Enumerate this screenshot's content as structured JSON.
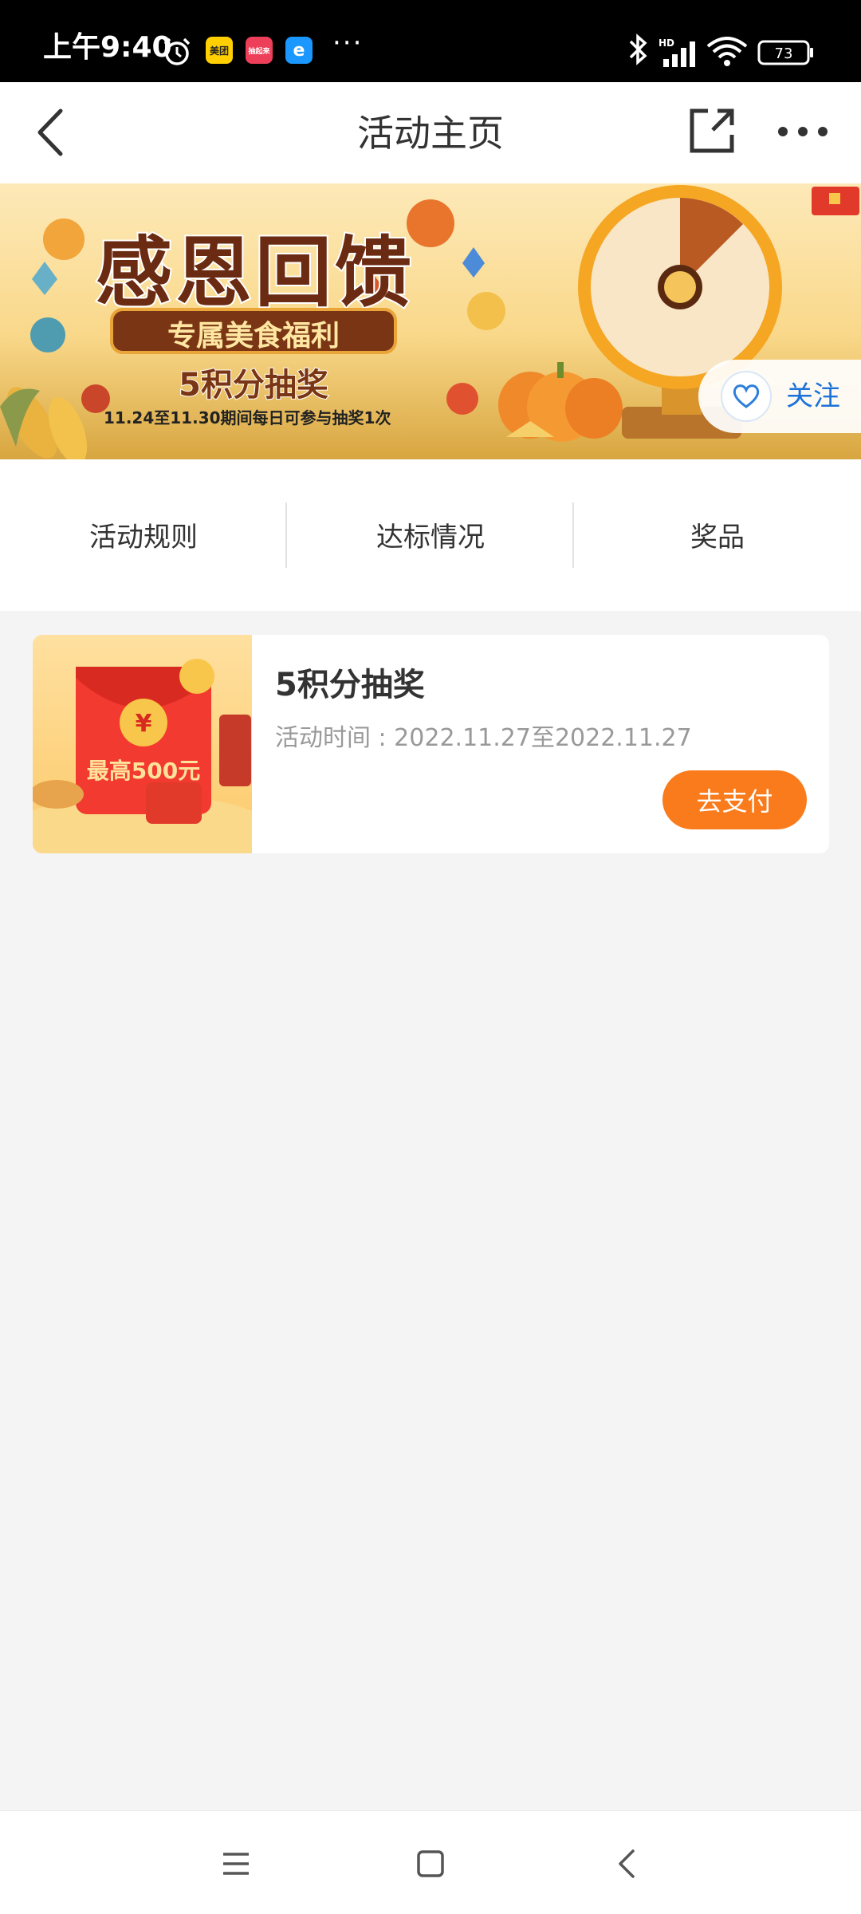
{
  "status_bar": {
    "time": "上午9:40",
    "apps": [
      {
        "name": "meituan-app-icon",
        "label": "美团",
        "color": "#ffcf00"
      },
      {
        "name": "app-icon-2",
        "label": "抽起来",
        "color": "#ee3f5a"
      },
      {
        "name": "eleme-app-icon",
        "label": "e",
        "color": "#1a98ff"
      }
    ],
    "more": "···",
    "network": "HD",
    "battery": "73"
  },
  "nav": {
    "title": "活动主页"
  },
  "banner": {
    "title": "感恩回馈",
    "subtitle": "专属美食福利",
    "subtitle2": "5积分抽奖",
    "date_note": "11.24至11.30期间每日可参与抽奖1次",
    "follow_label": "关注"
  },
  "tabs": [
    {
      "label": "活动规则"
    },
    {
      "label": "达标情况"
    },
    {
      "label": "奖品"
    }
  ],
  "activity": {
    "title": "5积分抽奖",
    "time": "活动时间 : 2022.11.27至2022.11.27",
    "thumb_text": "最高500元",
    "button": "去支付"
  },
  "colors": {
    "accent": "#fa7b1b",
    "link_blue": "#1c72d8",
    "background": "#f4f4f4"
  }
}
